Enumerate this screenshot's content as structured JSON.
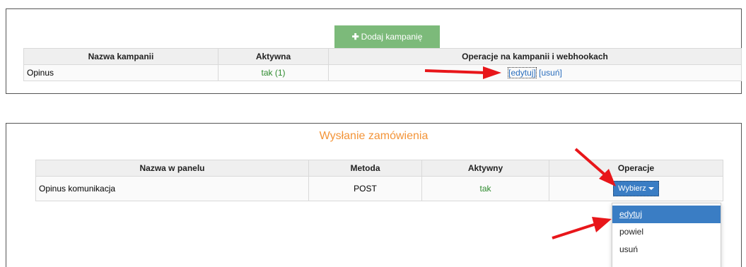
{
  "colors": {
    "add_button_bg": "#7cba7a",
    "title_orange": "#f39438",
    "active_green": "#2e8b2e",
    "link_blue": "#2a6ebd",
    "dropdown_blue": "#3a7dc4",
    "annotation_red": "#e8161a"
  },
  "campaigns": {
    "add_button_label": "Dodaj kampanię",
    "add_button_icon": "plus-icon",
    "columns": [
      "Nazwa kampanii",
      "Aktywna",
      "Operacje na kampanii i webhookach"
    ],
    "rows": [
      {
        "name": "Opinus",
        "active": "tak (1)",
        "edit_label": "[edytuj]",
        "delete_label": "[usuń]"
      }
    ]
  },
  "order_sending": {
    "title": "Wysłanie zamówienia",
    "columns": [
      "Nazwa w panelu",
      "Metoda",
      "Aktywny",
      "Operacje"
    ],
    "rows": [
      {
        "name": "Opinus komunikacja",
        "method": "POST",
        "active": "tak",
        "action_label": "Wybierz"
      }
    ],
    "dropdown_items": [
      "edytuj",
      "powiel",
      "usuń"
    ],
    "dropdown_highlighted": "edytuj"
  },
  "annotations": {
    "arrow_icon": "red-arrow-icon"
  }
}
